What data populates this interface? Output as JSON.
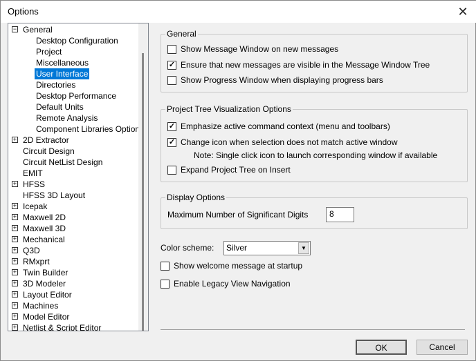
{
  "window": {
    "title": "Options",
    "close_icon": "close-icon"
  },
  "tree": [
    {
      "label": "General",
      "level": 0,
      "expander": "minus"
    },
    {
      "label": "Desktop Configuration",
      "level": 1
    },
    {
      "label": "Project",
      "level": 1
    },
    {
      "label": "Miscellaneous",
      "level": 1
    },
    {
      "label": "User Interface",
      "level": 1,
      "selected": true
    },
    {
      "label": "Directories",
      "level": 1
    },
    {
      "label": "Desktop Performance",
      "level": 1
    },
    {
      "label": "Default Units",
      "level": 1
    },
    {
      "label": "Remote Analysis",
      "level": 1
    },
    {
      "label": "Component Libraries Options",
      "level": 1
    },
    {
      "label": "2D Extractor",
      "level": 0,
      "expander": "plus"
    },
    {
      "label": "Circuit Design",
      "level": 0
    },
    {
      "label": "Circuit NetList Design",
      "level": 0
    },
    {
      "label": "EMIT",
      "level": 0
    },
    {
      "label": "HFSS",
      "level": 0,
      "expander": "plus"
    },
    {
      "label": "HFSS 3D Layout",
      "level": 0
    },
    {
      "label": "Icepak",
      "level": 0,
      "expander": "plus"
    },
    {
      "label": "Maxwell 2D",
      "level": 0,
      "expander": "plus"
    },
    {
      "label": "Maxwell 3D",
      "level": 0,
      "expander": "plus"
    },
    {
      "label": "Mechanical",
      "level": 0,
      "expander": "plus"
    },
    {
      "label": "Q3D",
      "level": 0,
      "expander": "plus"
    },
    {
      "label": "RMxprt",
      "level": 0,
      "expander": "plus"
    },
    {
      "label": "Twin Builder",
      "level": 0,
      "expander": "plus"
    },
    {
      "label": "3D Modeler",
      "level": 0,
      "expander": "plus"
    },
    {
      "label": "Layout Editor",
      "level": 0,
      "expander": "plus"
    },
    {
      "label": "Machines",
      "level": 0,
      "expander": "plus"
    },
    {
      "label": "Model Editor",
      "level": 0,
      "expander": "plus"
    },
    {
      "label": "Netlist & Script Editor",
      "level": 0,
      "expander": "plus"
    }
  ],
  "general": {
    "title": "General",
    "show_message_window": {
      "label": "Show Message Window on new messages",
      "checked": false
    },
    "ensure_visible": {
      "label": "Ensure that new messages are visible in the Message Window Tree",
      "checked": true
    },
    "show_progress": {
      "label": "Show Progress Window when displaying progress bars",
      "checked": false
    }
  },
  "project_tree": {
    "title": "Project Tree Visualization Options",
    "emphasize": {
      "label": "Emphasize active command context (menu and toolbars)",
      "checked": true
    },
    "change_icon": {
      "label": "Change icon when selection does not match active window",
      "checked": true
    },
    "note": "Note: Single click icon to launch corresponding window if available",
    "expand": {
      "label": "Expand Project Tree on Insert",
      "checked": false
    }
  },
  "display": {
    "title": "Display Options",
    "sig_digits_label": "Maximum Number of Significant Digits",
    "sig_digits_value": "8"
  },
  "color_scheme": {
    "label": "Color scheme:",
    "value": "Silver"
  },
  "welcome": {
    "label": "Show welcome message at startup",
    "checked": false
  },
  "legacy": {
    "label": "Enable Legacy View Navigation",
    "checked": false
  },
  "buttons": {
    "ok": "OK",
    "cancel": "Cancel"
  }
}
